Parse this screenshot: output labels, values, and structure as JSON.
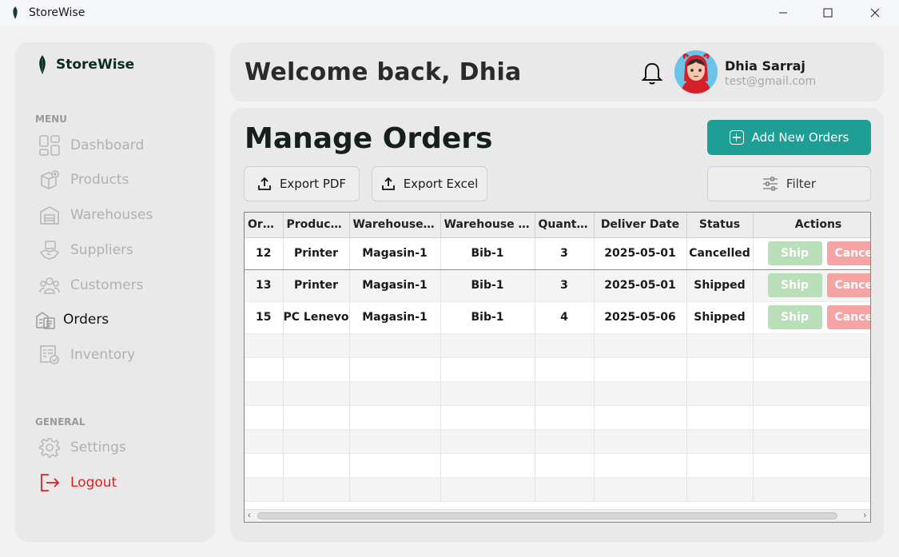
{
  "window": {
    "title": "StoreWise",
    "minimize_icon": "minimize-icon",
    "maximize_icon": "maximize-icon",
    "close_icon": "close-icon"
  },
  "brand": {
    "name": "StoreWise",
    "color": "#0d2a23"
  },
  "sidebar": {
    "menu_label": "MENU",
    "items": [
      {
        "label": "Dashboard",
        "icon": "dashboard-icon",
        "active": false
      },
      {
        "label": "Products",
        "icon": "products-icon",
        "active": false
      },
      {
        "label": "Warehouses",
        "icon": "warehouses-icon",
        "active": false
      },
      {
        "label": "Suppliers",
        "icon": "suppliers-icon",
        "active": false
      },
      {
        "label": "Customers",
        "icon": "customers-icon",
        "active": false
      },
      {
        "label": "Orders",
        "icon": "orders-icon",
        "active": true
      },
      {
        "label": "Inventory",
        "icon": "inventory-icon",
        "active": false
      }
    ],
    "general_label": "GENERAL",
    "general_items": [
      {
        "label": "Settings",
        "icon": "gear-icon"
      },
      {
        "label": "Logout",
        "icon": "logout-icon",
        "color": "#e01e1e"
      }
    ]
  },
  "header": {
    "welcome": "Welcome back, Dhia",
    "user": {
      "name": "Dhia Sarraj",
      "email": "test@gmail.com"
    }
  },
  "main": {
    "title": "Manage Orders",
    "add_button": "Add New Orders",
    "export_pdf": "Export PDF",
    "export_excel": "Export Excel",
    "filter": "Filter",
    "accent": "#1e9e94"
  },
  "table": {
    "columns": [
      "Ord...",
      "Product ...",
      "Warehouse S...",
      "Warehouse D...",
      "Quantity",
      "Deliver Date",
      "Status",
      "Actions"
    ],
    "rows": [
      {
        "cells": [
          "12",
          "Printer",
          "Magasin-1",
          "Bib-1",
          "3",
          "2025-05-01",
          "Cancelled"
        ],
        "ship": "Ship",
        "cancel": "Cancel"
      },
      {
        "cells": [
          "13",
          "Printer",
          "Magasin-1",
          "Bib-1",
          "3",
          "2025-05-01",
          "Shipped"
        ],
        "ship": "Ship",
        "cancel": "Cancel"
      },
      {
        "cells": [
          "15",
          "PC Lenevo",
          "Magasin-1",
          "Bib-1",
          "4",
          "2025-05-06",
          "Shipped"
        ],
        "ship": "Ship",
        "cancel": "Cancel"
      }
    ]
  }
}
